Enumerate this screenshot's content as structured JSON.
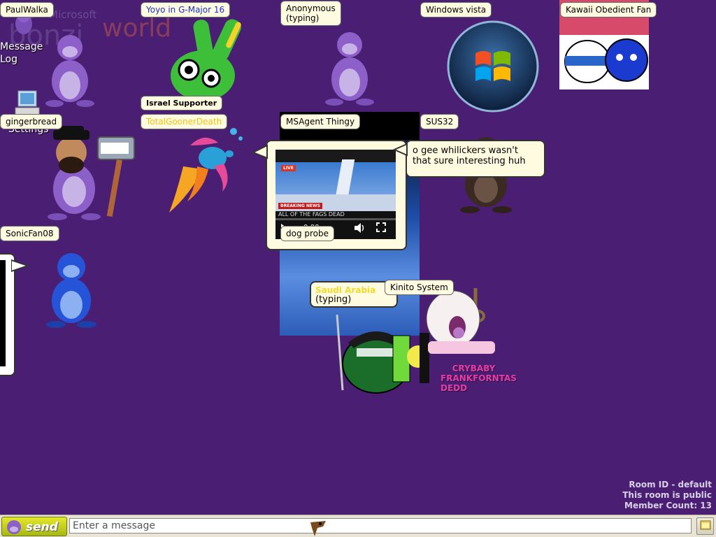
{
  "app": {
    "logo_small": "Microsoft",
    "logo_big": "bonzi",
    "logo_world": "world"
  },
  "desktop": {
    "message_log_label": "Message Log",
    "settings_label": "Settings"
  },
  "users": [
    {
      "name": "PaulWalka"
    },
    {
      "name": "Yoyo in G-Major 16"
    },
    {
      "name": "Anonymous\n(typing)"
    },
    {
      "name": "Windows vista"
    },
    {
      "name": "Kawaii Obedient Fan"
    },
    {
      "name": "Israel Supporter"
    },
    {
      "name": "gingerbread"
    },
    {
      "name": "TotalGoonerDeath"
    },
    {
      "name": "MSAgent Thingy"
    },
    {
      "name": "SUS32"
    },
    {
      "name": "SonicFan08"
    },
    {
      "name": "dog probe"
    },
    {
      "name": "Kinito System"
    },
    {
      "name": "(typing)"
    }
  ],
  "bubbles": {
    "sus32_message": "o gee whilickers wasn't that sure interesting huh"
  },
  "video": {
    "live_badge": "LIVE",
    "breaking_label": "BREAKING NEWS",
    "headline": "ALL OF THE FAGS DEAD",
    "time": "0:00"
  },
  "overlay_text": {
    "pink_lines": "CRYBABY\nFRANKFORNTAS\nDEDD",
    "green_name": "Saudi Arabia"
  },
  "room": {
    "id_line": "Room ID - default",
    "public_line": "This room is public",
    "count_line": "Member Count: 13"
  },
  "composer": {
    "send_label": "send",
    "placeholder": "Enter a message"
  },
  "colors": {
    "background": "#4a1f73",
    "bonzi_purple": "#8d5fc9",
    "tag_bg": "#fffbe0",
    "send_green": "#c9d41a"
  }
}
